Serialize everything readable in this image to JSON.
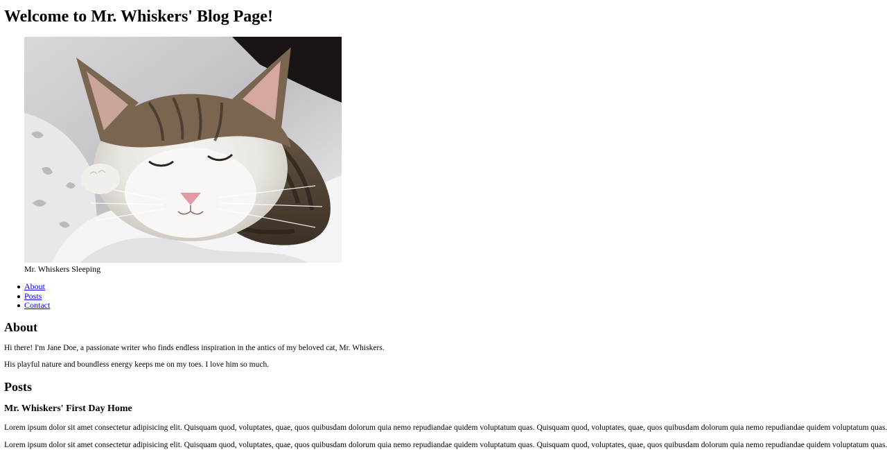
{
  "header": {
    "title": "Welcome to Mr. Whiskers' Blog Page!"
  },
  "hero": {
    "image_alt": "Mr. Whiskers Sleeping",
    "caption": "Mr. Whiskers Sleeping"
  },
  "nav": {
    "items": [
      {
        "label": "About"
      },
      {
        "label": "Posts"
      },
      {
        "label": "Contact"
      }
    ]
  },
  "about": {
    "heading": "About",
    "paragraphs": [
      "Hi there! I'm Jane Doe, a passionate writer who finds endless inspiration in the antics of my beloved cat, Mr. Whiskers.",
      "His playful nature and boundless energy keeps me on my toes. I love him so much."
    ]
  },
  "posts": {
    "heading": "Posts",
    "items": [
      {
        "title": "Mr. Whiskers' First Day Home",
        "paragraphs": [
          "Lorem ipsum dolor sit amet consectetur adipisicing elit. Quisquam quod, voluptates, quae, quos quibusdam dolorum quia nemo repudiandae quidem voluptatum quas. Quisquam quod, voluptates, quae, quos quibusdam dolorum quia nemo repudiandae quidem voluptatum quas.",
          "Lorem ipsum dolor sit amet consectetur adipisicing elit. Quisquam quod, voluptates, quae, quos quibusdam dolorum quia nemo repudiandae quidem voluptatum quas. Quisquam quod, voluptates, quae, quos quibusdam dolorum quia nemo repudiandae quidem voluptatum quas."
        ]
      }
    ]
  },
  "colors": {
    "link": "#0000ee",
    "text": "#000000",
    "background": "#ffffff"
  }
}
